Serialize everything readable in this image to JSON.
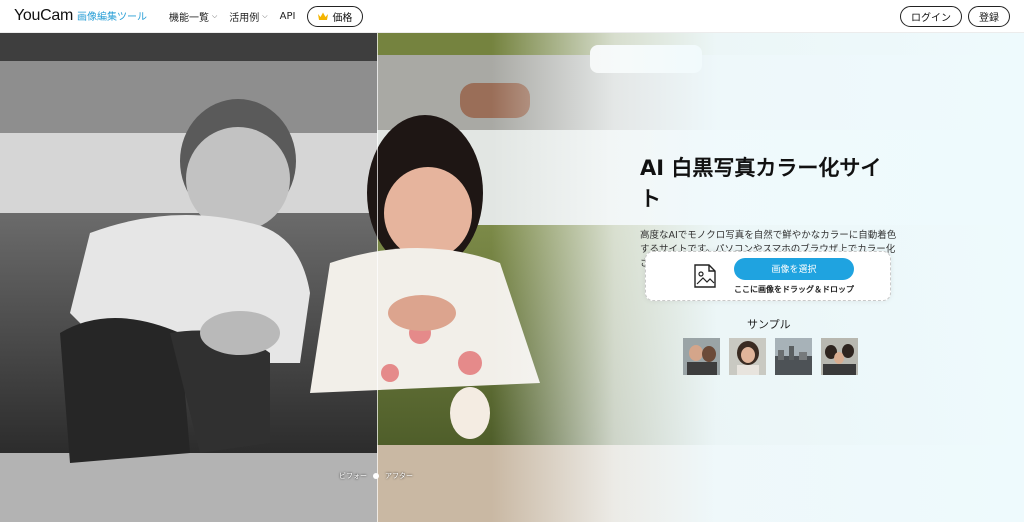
{
  "nav": {
    "brand": "YouCam",
    "brand_sub": "画像編集ツール",
    "links": [
      {
        "label": "機能一覧",
        "icon": "chevron-down-icon"
      },
      {
        "label": "活用例",
        "icon": "chevron-down-icon"
      },
      {
        "label": "API"
      }
    ],
    "price_label": "価格",
    "price_icon": "crown-icon",
    "login_label": "ログイン",
    "signup_label": "登録"
  },
  "hero": {
    "title": "AI 白黒写真カラー化サイト",
    "description": "高度なAIでモノクロ写真を自然で鮮やかなカラーに自動着色するサイトです。パソコンやスマホのブラウザ上でカラー化させることができます。",
    "before_label": "ビフォー",
    "after_label": "アフター",
    "upload": {
      "icon": "image-file-icon",
      "button_label": "画像を選択",
      "drag_hint": "ここに画像をドラッグ＆ドロップ"
    },
    "sample_title": "サンプル",
    "samples": [
      "sample-couple",
      "sample-woman",
      "sample-city",
      "sample-family"
    ]
  },
  "colors": {
    "accent": "#1fa3e0",
    "brand_sub": "#2a9fd6",
    "hero_bg": "#eefafd"
  }
}
